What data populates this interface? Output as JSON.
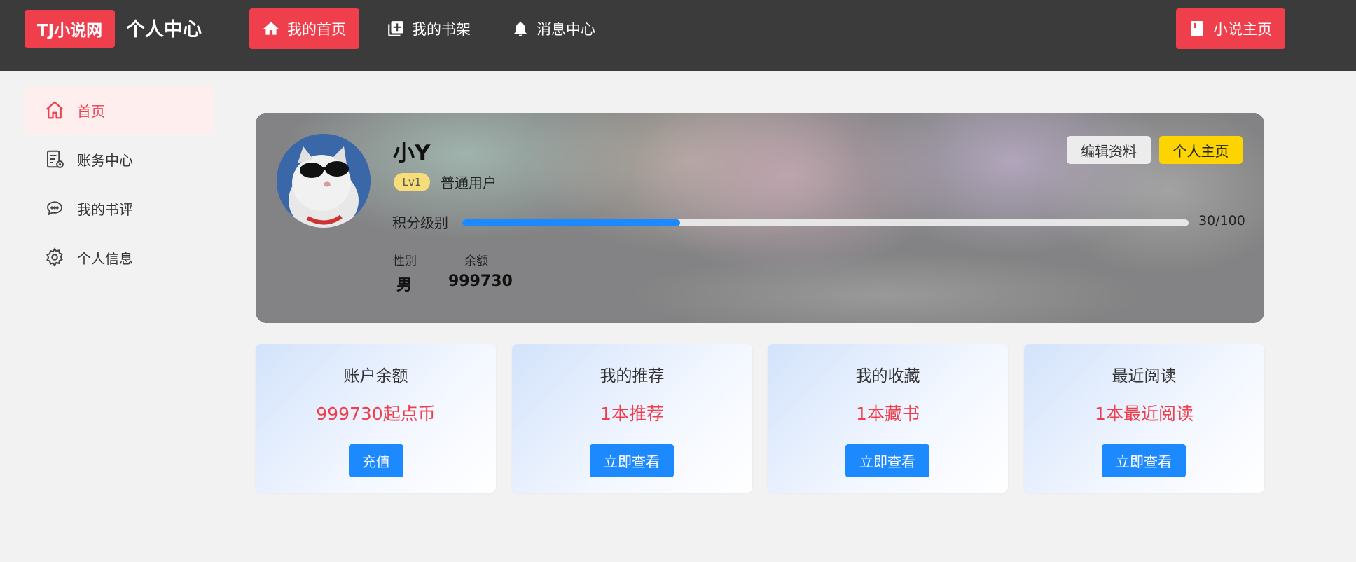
{
  "header": {
    "logo": "TJ小说网",
    "title": "个人中心",
    "nav": [
      {
        "label": "我的首页",
        "icon": "home-icon",
        "active": true
      },
      {
        "label": "我的书架",
        "icon": "library-add-icon",
        "active": false
      },
      {
        "label": "消息中心",
        "icon": "bell-icon",
        "active": false
      }
    ],
    "novel_home": {
      "label": "小说主页",
      "icon": "book-icon"
    }
  },
  "sidebar": {
    "items": [
      {
        "label": "首页",
        "icon": "home-outline-icon",
        "active": true
      },
      {
        "label": "账务中心",
        "icon": "bill-icon",
        "active": false
      },
      {
        "label": "我的书评",
        "icon": "comment-icon",
        "active": false
      },
      {
        "label": "个人信息",
        "icon": "gear-icon",
        "active": false
      }
    ]
  },
  "profile": {
    "username": "小Y",
    "level_badge": "Lv1",
    "role": "普通用户",
    "edit_label": "编辑资料",
    "homepage_label": "个人主页",
    "score_label": "积分级别",
    "progress_text": "30/100",
    "progress_fraction": 0.3,
    "stats": [
      {
        "label": "性别",
        "value": "男"
      },
      {
        "label": "余额",
        "value": "999730"
      }
    ]
  },
  "cards": [
    {
      "title": "账户余额",
      "value": "999730起点币",
      "button": "充值"
    },
    {
      "title": "我的推荐",
      "value": "1本推荐",
      "button": "立即查看"
    },
    {
      "title": "我的收藏",
      "value": "1本藏书",
      "button": "立即查看"
    },
    {
      "title": "最近阅读",
      "value": "1本最近阅读",
      "button": "立即查看"
    }
  ],
  "colors": {
    "accent_red": "#ef3f4d",
    "button_blue": "#1d89ff",
    "topbar": "#3b3b3b",
    "badge_yellow": "#fdd300"
  }
}
